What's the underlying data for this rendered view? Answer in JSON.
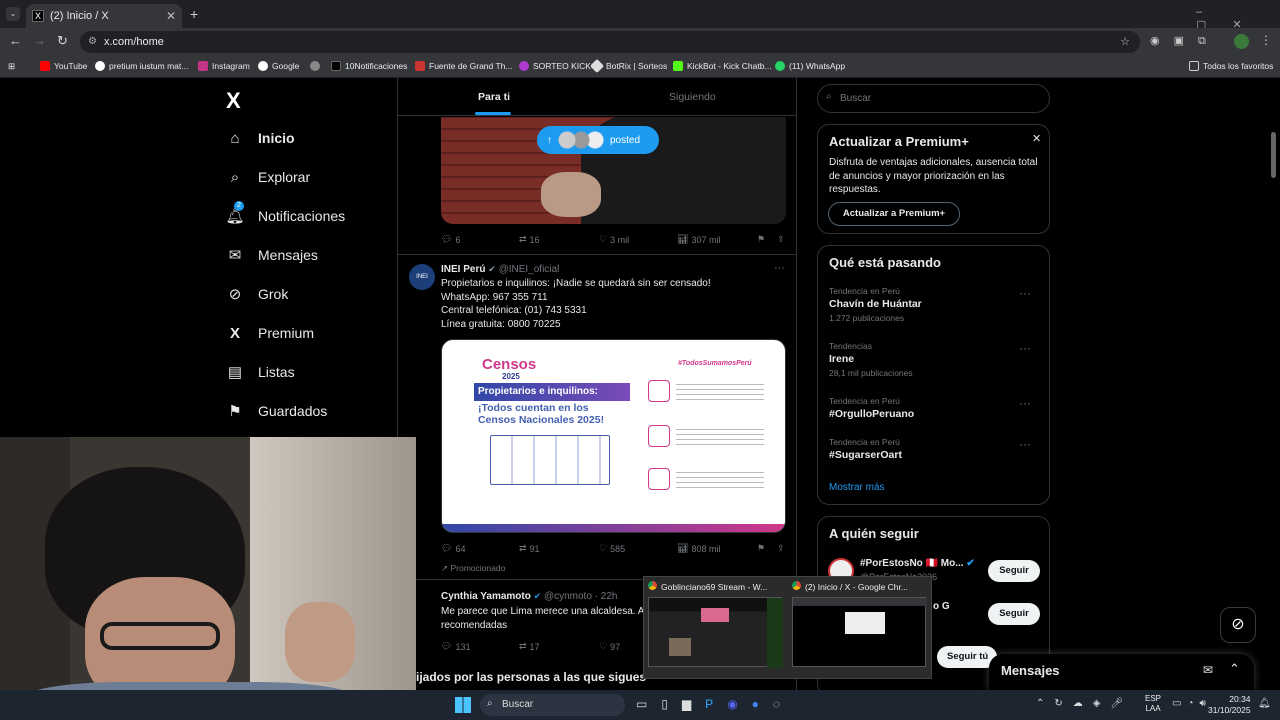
{
  "browser": {
    "tab_title": "(2) Inicio / X",
    "url": "x.com/home",
    "bookmarks": [
      "YouTube",
      "pretium iustum mat...",
      "Instagram",
      "Google",
      "10Notificaciones",
      "Fuente de Grand Th...",
      "SORTEO KICK",
      "BotRix | Sorteos",
      "KickBot - Kick Chatb...",
      "(11) WhatsApp"
    ],
    "bookmarks_folder": "Todos los favoritos"
  },
  "nav": {
    "logo": "X",
    "items": [
      {
        "label": "Inicio",
        "icon": "home-icon"
      },
      {
        "label": "Explorar",
        "icon": "search-icon"
      },
      {
        "label": "Notificaciones",
        "icon": "bell-icon",
        "badge": "2"
      },
      {
        "label": "Mensajes",
        "icon": "mail-icon"
      },
      {
        "label": "Grok",
        "icon": "grok-icon"
      },
      {
        "label": "Premium",
        "icon": "x-icon"
      },
      {
        "label": "Listas",
        "icon": "list-icon"
      },
      {
        "label": "Guardados",
        "icon": "bookmark-icon"
      }
    ]
  },
  "feed": {
    "tabs": [
      "Para ti",
      "Siguiendo"
    ],
    "posted_pill": "posted",
    "tweet1_actions": {
      "replies": "6",
      "retweets": "16",
      "likes": "3 mil",
      "views": "307 mil"
    },
    "tweet2": {
      "name": "INEI Perú",
      "handle": "@INEI_oficial",
      "lines": [
        "Propietarios e inquilinos: ¡Nadie se quedará sin ser censado!",
        "WhatsApp: 967 355 711",
        "Central telefónica: (01) 743 5331",
        "Línea gratuita: 0800 70225"
      ],
      "image": {
        "title": "Censos",
        "year": "2025",
        "hashtag": "#TodosSumamosPerú",
        "headline1": "Propietarios e inquilinos:",
        "headline2": "¡Todos cuentan en los",
        "headline3": "Censos Nacionales 2025!"
      },
      "actions": {
        "replies": "64",
        "retweets": "91",
        "likes": "585",
        "views": "808 mil"
      },
      "promoted": "Promocionado"
    },
    "tweet3": {
      "name": "Cynthia Yamamoto",
      "handle": "@cynmoto",
      "time": "· 22h",
      "lines": [
        "Me parece que Lima merece una alcaldesa. A",
        "recomendadas"
      ],
      "actions": {
        "replies": "131",
        "retweets": "17",
        "likes": "97"
      }
    },
    "bottom_banner": "ijados por las personas a las que sigues"
  },
  "right": {
    "search_placeholder": "Buscar",
    "premium": {
      "title": "Actualizar a Premium+",
      "body": "Disfruta de ventajas adicionales, ausencia total de anuncios y mayor priorización en las respuestas.",
      "button": "Actualizar a Premium+"
    },
    "trends_title": "Qué está pasando",
    "trends": [
      {
        "category": "Tendencia en Perú",
        "name": "Chavín de Huántar",
        "count": "1.272 publicaciones"
      },
      {
        "category": "Tendencias",
        "name": "Irene",
        "count": "28,1 mil publicaciones"
      },
      {
        "category": "Tendencia en Perú",
        "name": "#OrgulloPeruano",
        "count": ""
      },
      {
        "category": "Tendencia en Perú",
        "name": "#SugarserOart",
        "count": ""
      }
    ],
    "show_more": "Mostrar más",
    "follow_title": "A quién seguir",
    "follow": [
      {
        "name": "#PorEstosNo 🇵🇪 Mo...",
        "handle": "@PorEstosNo2026",
        "button": "Seguir"
      },
      {
        "name": "o G",
        "handle": "",
        "button": "Seguir"
      },
      {
        "name": "",
        "handle": "",
        "button": "Seguir tú"
      }
    ],
    "messages_drawer": "Mensajes"
  },
  "thumbnails": [
    "Goblinciano69 Stream - W...",
    "(2) Inicio / X - Google Chr..."
  ],
  "taskbar": {
    "search": "Buscar",
    "lang": "ESP",
    "lang2": "LAA",
    "time": "20:34",
    "date": "31/10/2025"
  }
}
